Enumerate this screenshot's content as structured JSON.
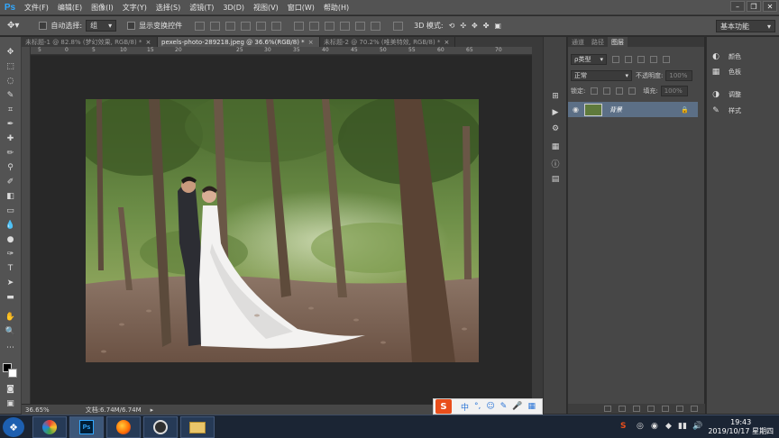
{
  "app": {
    "logo": "Ps"
  },
  "menu": [
    "文件(F)",
    "编辑(E)",
    "图像(I)",
    "文字(Y)",
    "选择(S)",
    "滤镜(T)",
    "3D(D)",
    "视图(V)",
    "窗口(W)",
    "帮助(H)"
  ],
  "window_controls": {
    "minimize": "–",
    "restore": "❐",
    "close": "✕"
  },
  "options": {
    "auto_select_label": "自动选择:",
    "auto_select_value": "组",
    "show_transform_label": "显示变换控件",
    "mode_3d_label": "3D 模式:",
    "workspace": "基本功能"
  },
  "doc_tabs": [
    {
      "title": "未标题-1 @ 82.8% (梦幻效果, RGB/8) *",
      "close": "×",
      "active": false
    },
    {
      "title": "pexels-photo-289218.jpeg @ 36.6%(RGB/8) *",
      "close": "×",
      "active": true
    },
    {
      "title": "未标题-2 @ 70.2% (唯美特效, RGB/8) *",
      "close": "×",
      "active": false
    }
  ],
  "ruler": [
    "5",
    "0",
    "5",
    "10",
    "15",
    "20",
    "25",
    "30",
    "35",
    "40",
    "45",
    "50",
    "55",
    "60",
    "65",
    "70"
  ],
  "status": {
    "zoom": "36.65%",
    "doc_info": "文档:6.74M/6.74M"
  },
  "layers": {
    "tabs": [
      "通道",
      "路径",
      "图层"
    ],
    "kind_label": "ρ类型",
    "blend_mode": "正常",
    "opacity_label": "不透明度:",
    "opacity_value": "100%",
    "lock_label": "锁定:",
    "fill_label": "填充:",
    "fill_value": "100%",
    "layer_name": "背景"
  },
  "adjust": [
    {
      "icon": "palette-icon",
      "label": "颜色"
    },
    {
      "icon": "swatches-icon",
      "label": "色板"
    },
    {
      "icon": "adjustments-icon",
      "label": "调整"
    },
    {
      "icon": "styles-icon",
      "label": "样式"
    }
  ],
  "ime": {
    "logo": "S",
    "lang": "中"
  },
  "taskbar": {
    "time": "19:43",
    "date": "2019/10/17 星期四"
  },
  "colors": {
    "panel": "#535353",
    "canvas": "#282828",
    "selection": "#5c6f86",
    "ps_blue": "#31a8ff"
  }
}
